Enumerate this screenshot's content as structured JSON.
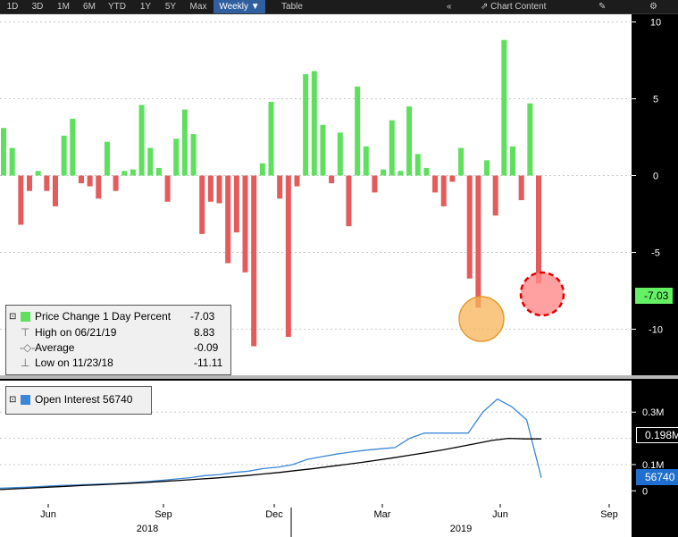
{
  "toolbar": {
    "ranges": [
      "1D",
      "3D",
      "1M",
      "6M",
      "YTD",
      "1Y",
      "5Y",
      "Max"
    ],
    "period": "Weekly ▼",
    "table": "Table",
    "chart_content": "Chart Content"
  },
  "legend_top": {
    "title": "Price Change 1 Day Percent",
    "title_value": "-7.03",
    "high_label": "High on 06/21/19",
    "high_value": "8.83",
    "avg_label": "Average",
    "avg_value": "-0.09",
    "low_label": "Low on 11/23/18",
    "low_value": "-11.11"
  },
  "legend_bottom": {
    "title": "Open Interest 56740"
  },
  "flags": {
    "price_last": "-7.03",
    "oi_mid": "0.198M",
    "oi_last": "56740"
  },
  "colors": {
    "up": "#5ee05e",
    "down": "#e55b5b",
    "oi_line": "#3b86d6",
    "avg_line": "#000000",
    "bg": "#ffffff"
  },
  "axis": {
    "y_top_ticks": [
      "10",
      "5",
      "0",
      "-5",
      "-10"
    ],
    "y_bottom_ticks": [
      "0.3M",
      "0.1M",
      "0"
    ],
    "x_months": [
      "Jun",
      "Sep",
      "Dec",
      "Mar",
      "Jun",
      "Sep"
    ],
    "x_years": [
      "2018",
      "2019"
    ]
  },
  "chart_data": [
    {
      "type": "bar",
      "title": "Price Change 1 Day Percent",
      "series": [
        {
          "values": [
            3.1,
            1.8,
            -3.2,
            -1.0,
            0.3,
            -1.0,
            -2.0,
            2.6,
            3.7,
            -0.5,
            -0.7,
            -1.5,
            2.2,
            -1.0,
            0.3,
            0.4,
            4.6,
            1.8,
            0.5,
            -1.7,
            2.4,
            4.3,
            2.7,
            -3.8,
            -1.7,
            -1.8,
            -5.7,
            -3.7,
            -6.3,
            -11.11,
            0.8,
            4.8,
            -1.5,
            -10.5,
            -0.7,
            6.6,
            6.8,
            3.3,
            -0.5,
            2.8,
            -3.3,
            5.8,
            1.9,
            -1.1,
            0.4,
            3.6,
            0.3,
            4.5,
            1.4,
            0.5,
            -1.1,
            -2.0,
            -0.4,
            1.8,
            -6.7,
            -8.6,
            1.0,
            -2.6,
            8.83,
            1.9,
            -1.6,
            4.7,
            -7.03
          ],
          "ylim": [
            -13,
            10.5
          ]
        }
      ]
    },
    {
      "type": "line",
      "title": "Open Interest",
      "series": [
        {
          "name": "Open Interest",
          "values": [
            0.01,
            0.012,
            0.014,
            0.017,
            0.02,
            0.022,
            0.024,
            0.026,
            0.028,
            0.031,
            0.035,
            0.04,
            0.045,
            0.05,
            0.058,
            0.062,
            0.07,
            0.075,
            0.085,
            0.09,
            0.1,
            0.12,
            0.13,
            0.14,
            0.148,
            0.155,
            0.16,
            0.165,
            0.2,
            0.22,
            0.22,
            0.22,
            0.22,
            0.3,
            0.35,
            0.32,
            0.27,
            0.05
          ]
        },
        {
          "name": "",
          "values": [
            0.005,
            0.008,
            0.011,
            0.014,
            0.017,
            0.02,
            0.023,
            0.026,
            0.029,
            0.032,
            0.036,
            0.04,
            0.044,
            0.048,
            0.053,
            0.058,
            0.064,
            0.07,
            0.077,
            0.084,
            0.092,
            0.1,
            0.108,
            0.117,
            0.126,
            0.136,
            0.146,
            0.156,
            0.168,
            0.18,
            0.192,
            0.2,
            0.198,
            0.198
          ]
        }
      ],
      "ylim": [
        -0.05,
        0.42
      ]
    }
  ]
}
